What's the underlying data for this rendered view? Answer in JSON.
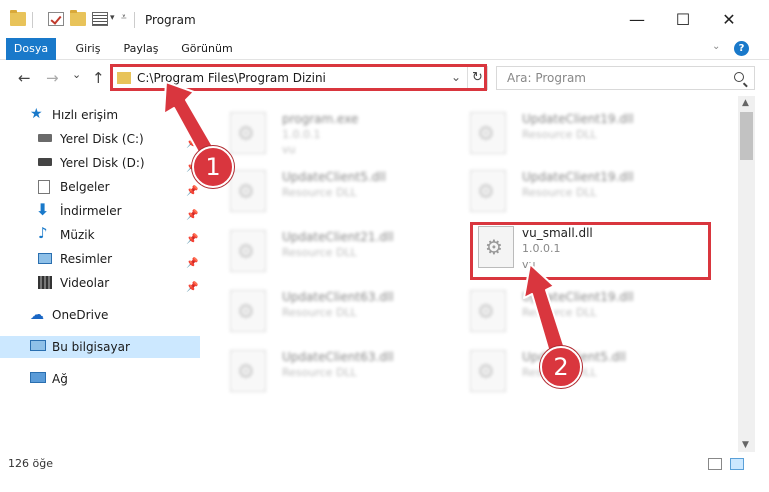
{
  "window": {
    "title": "Program",
    "controls": {
      "minimize": "—",
      "maximize": "☐",
      "close": "✕"
    }
  },
  "ribbon": {
    "tabs": [
      {
        "label": "Dosya",
        "active": true
      },
      {
        "label": "Giriş",
        "active": false
      },
      {
        "label": "Paylaş",
        "active": false
      },
      {
        "label": "Görünüm",
        "active": false
      }
    ],
    "expand_icon": "chevron-down-icon",
    "help_icon": "help-icon"
  },
  "navigation": {
    "back": "←",
    "forward": "→",
    "recent": "⌄",
    "up": "↑",
    "address": "C:\\Program Files\\Program Dizini",
    "refresh": "↻",
    "search_placeholder": "Ara: Program"
  },
  "sidebar": {
    "quick_access": {
      "label": "Hızlı erişim"
    },
    "items": [
      {
        "label": "Yerel Disk (C:)",
        "pinned": true
      },
      {
        "label": "Yerel Disk (D:)",
        "pinned": true
      },
      {
        "label": "Belgeler",
        "pinned": true
      },
      {
        "label": "İndirmeler",
        "pinned": true
      },
      {
        "label": "Müzik",
        "pinned": true
      },
      {
        "label": "Resimler",
        "pinned": true
      },
      {
        "label": "Videolar",
        "pinned": true
      }
    ],
    "onedrive": {
      "label": "OneDrive"
    },
    "this_pc": {
      "label": "Bu bilgisayar",
      "selected": true
    },
    "network": {
      "label": "Ağ"
    }
  },
  "files": [
    {
      "name": "program.exe",
      "line2": "1.0.0.1",
      "line3": "vu",
      "blurred": true
    },
    {
      "name": "UpdateClient19.dll",
      "line2": "Resource DLL",
      "line3": "",
      "blurred": true
    },
    {
      "name": "UpdateClient5.dll",
      "line2": "Resource DLL",
      "line3": "",
      "blurred": true
    },
    {
      "name": "UpdateClient19.dll",
      "line2": "Resource DLL",
      "line3": "",
      "blurred": true
    },
    {
      "name": "UpdateClient21.dll",
      "line2": "Resource DLL",
      "line3": "",
      "blurred": true
    },
    {
      "name": "vu_small.dll",
      "line2": "1.0.0.1",
      "line3": "vu",
      "blurred": false
    },
    {
      "name": "UpdateClient63.dll",
      "line2": "Resource DLL",
      "line3": "",
      "blurred": true
    },
    {
      "name": "UpdateClient19.dll",
      "line2": "Resource DLL",
      "line3": "",
      "blurred": true
    },
    {
      "name": "UpdateClient63.dll",
      "line2": "Resource DLL",
      "line3": "",
      "blurred": true
    },
    {
      "name": "UpdateClient5.dll",
      "line2": "Resource DLL",
      "line3": "",
      "blurred": true
    }
  ],
  "status": {
    "item_count": "126 öğe"
  },
  "annotations": {
    "step1": "1",
    "step2": "2",
    "highlight_color": "#d9363e"
  }
}
